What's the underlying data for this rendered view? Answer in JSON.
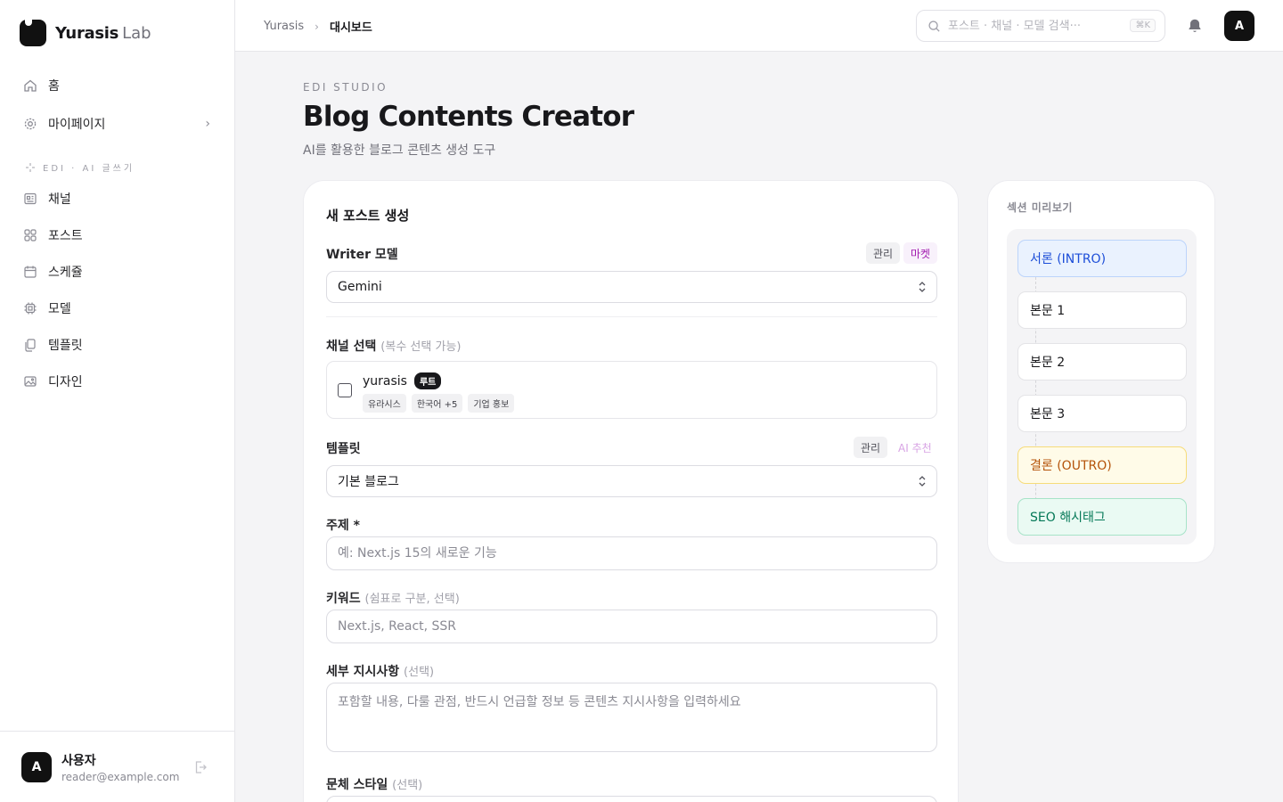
{
  "brand": {
    "name": "Yurasis",
    "suffix": "Lab"
  },
  "sidebar": {
    "top_items": [
      {
        "label": "홈",
        "icon": "home-icon"
      },
      {
        "label": "마이페이지",
        "icon": "gear-icon"
      }
    ],
    "section_label": "EDI · AI 글쓰기",
    "items": [
      {
        "label": "채널",
        "icon": "newspaper-icon"
      },
      {
        "label": "포스트",
        "icon": "grid-icon"
      },
      {
        "label": "스케쥴",
        "icon": "calendar-icon"
      },
      {
        "label": "모델",
        "icon": "chip-icon"
      },
      {
        "label": "템플릿",
        "icon": "copy-icon"
      },
      {
        "label": "디자인",
        "icon": "image-icon"
      }
    ],
    "user": {
      "initial": "A",
      "name": "사용자",
      "email": "reader@example.com"
    }
  },
  "header": {
    "breadcrumb": {
      "root": "Yurasis",
      "current": "대시보드"
    },
    "search_placeholder": "포스트 · 채널 · 모델 검색···",
    "search_shortcut": "⌘K",
    "avatar_initial": "A"
  },
  "page": {
    "eyebrow": "EDI STUDIO",
    "title": "Blog Contents Creator",
    "subtitle": "AI를 활용한 블로그 콘텐츠 생성 도구"
  },
  "form": {
    "title": "새 포스트 생성",
    "writer": {
      "label": "Writer 모델",
      "manage": "관리",
      "market": "마켓",
      "value": "Gemini"
    },
    "channel": {
      "label": "채널 선택",
      "hint": "(복수 선택 가능)",
      "name": "yurasis",
      "badge": "루트",
      "tags": [
        "유라시스",
        "한국어 +5",
        "기업 홍보"
      ]
    },
    "template": {
      "label": "템플릿",
      "manage": "관리",
      "ai": "AI 추천",
      "value": "기본 블로그"
    },
    "topic": {
      "label": "주제 *",
      "placeholder": "예: Next.js 15의 새로운 기능"
    },
    "keywords": {
      "label": "키워드",
      "hint": "(쉼표로 구분, 선택)",
      "placeholder": "Next.js, React, SSR"
    },
    "details": {
      "label": "세부 지시사항",
      "hint": "(선택)",
      "placeholder": "포함할 내용, 다룰 관점, 반드시 언급할 정보 등 콘텐츠 지시사항을 입력하세요"
    },
    "style": {
      "label": "문체 스타일",
      "hint": "(선택)"
    }
  },
  "preview": {
    "title": "섹션 미리보기",
    "sections": [
      "서론 (INTRO)",
      "본문 1",
      "본문 2",
      "본문 3",
      "결론 (OUTRO)",
      "SEO 해시태그"
    ]
  }
}
